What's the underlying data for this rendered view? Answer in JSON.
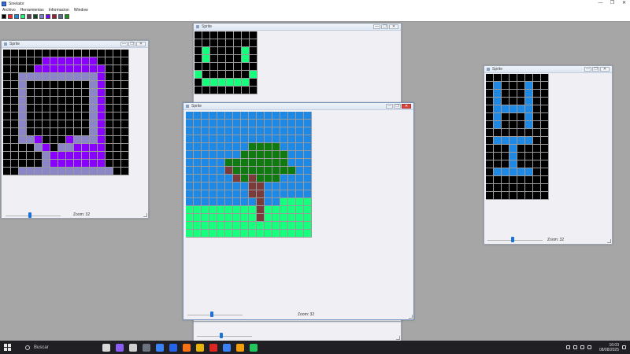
{
  "app": {
    "title": "Sinelator",
    "window_controls": [
      "—",
      "❐",
      "✕"
    ]
  },
  "menu": {
    "items": [
      "Archivo",
      "Herramientas",
      "Informacion",
      "Window"
    ]
  },
  "palette": {
    "colors": [
      "#000000",
      "#ff2020",
      "#1e88e5",
      "#16ff7d",
      "#6b3a5a",
      "#0f4a1f",
      "#7d7dcc",
      "#7c00ff",
      "#9e1b32",
      "#55698a",
      "#1a8f1a"
    ]
  },
  "window_buttons": {
    "minimize": "—",
    "maximize": "❐",
    "close": "✕"
  },
  "colors": {
    "0": "#000000",
    "1": "#1e88e5",
    "2": "#16ff7d",
    "3": "#0f7a0f",
    "4": "#7c3b3b",
    "5": "#8a00ff",
    "6": "#8a86c8",
    "E": "#b9b9b9"
  },
  "windows": [
    {
      "id": "w1",
      "title": "Sprite",
      "zoom_label": "Zoom: 32",
      "rows": [
        "0000000000000000",
        "0000055555550000",
        "0000555555555000",
        "0066666666665000",
        "0060000000065000",
        "0060000000065000",
        "0060000000065000",
        "0060000000065000",
        "0060000000065000",
        "0060000000065000",
        "0060000000065000",
        "0066500056665000",
        "0000650665555000",
        "0000065555555000",
        "0000065555555000",
        "0066666666666600"
      ]
    },
    {
      "id": "w2",
      "title": "Sprite",
      "zoom_label": "",
      "rows": [
        "00000000",
        "00000000",
        "02000020",
        "02000020",
        "00000000",
        "20000002",
        "02222220",
        "00000000"
      ]
    },
    {
      "id": "w3",
      "title": "Sprite",
      "zoom_label": "Zoom: 32",
      "rows": [
        "1111111111111111",
        "1111111111111111",
        "1111111111111111",
        "1111111111111111",
        "1111111133331111",
        "1111111333333111",
        "1111133333333111",
        "1111143333333311",
        "1111114343331111",
        "1111111144111111",
        "1111111144111111",
        "1111111114112222",
        "2222222224222222",
        "2222222224222222",
        "2222222222222222",
        "2222222222222222"
      ]
    },
    {
      "id": "w4",
      "title": "Sprite",
      "zoom_label": "Zoom: 32",
      "rows": [
        "00000000",
        "01000100",
        "01000100",
        "01000100",
        "01111100",
        "01000100",
        "01000100",
        "00000000",
        "01111100",
        "00010000",
        "00010000",
        "00010000",
        "01111100",
        "00000000",
        "00000000",
        "00000000"
      ]
    }
  ],
  "bottom_window": {
    "zoom_label": ""
  },
  "taskbar": {
    "search_placeholder": "Buscar",
    "app_icons": [
      "#d8d8d8",
      "#8b5cf6",
      "#cfcfcf",
      "#6b7280",
      "#3b82f6",
      "#2563eb",
      "#f97316",
      "#eab308",
      "#dc2626",
      "#3b82f6",
      "#f59e0b",
      "#22c55e"
    ],
    "time": "16:03",
    "date": "08/08/2025"
  }
}
